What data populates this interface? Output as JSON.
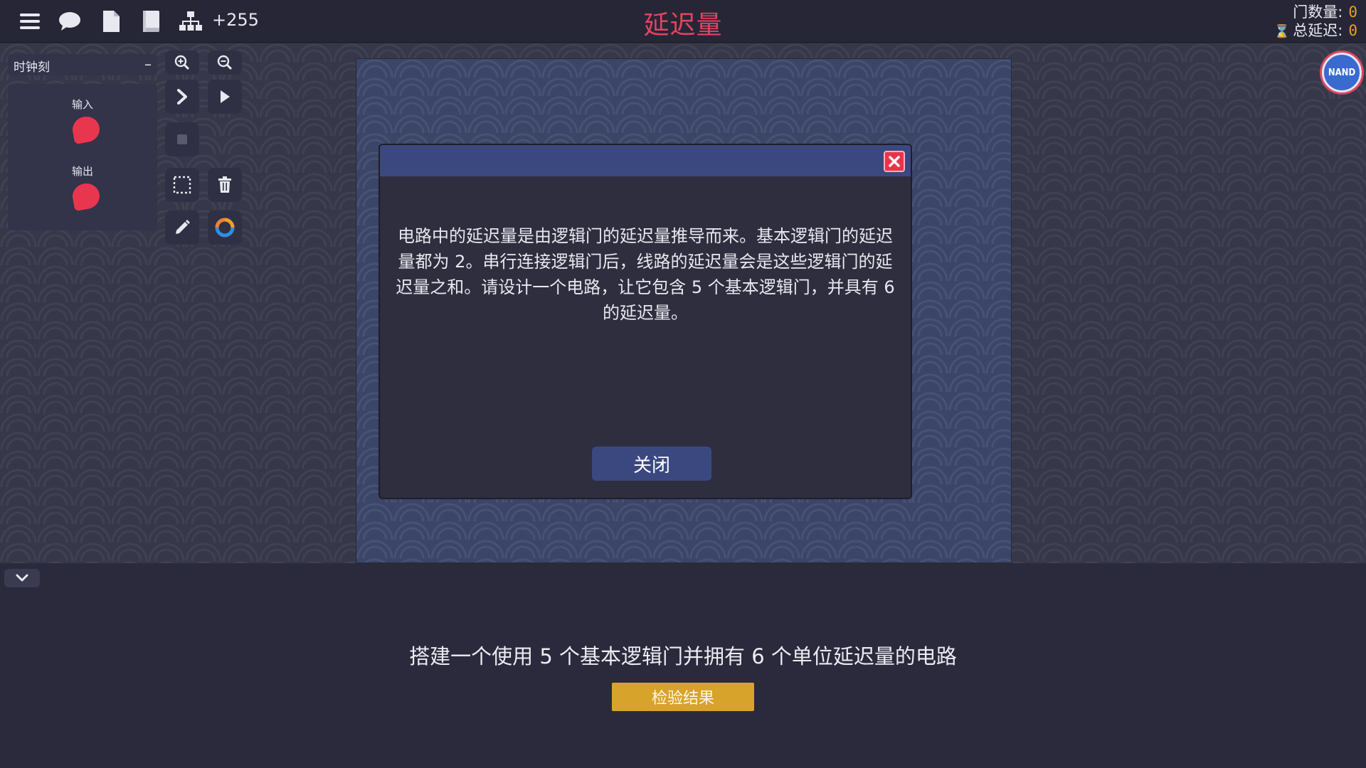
{
  "topbar": {
    "icons": [
      "menu-icon",
      "chat-icon",
      "document-icon",
      "book-icon",
      "hierarchy-icon"
    ],
    "score": "+255",
    "title": "延迟量",
    "gate_count_label": "门数量:",
    "gate_count_value": "0",
    "total_delay_label": "总延迟:",
    "total_delay_value": "0"
  },
  "palette": {
    "header": "时钟刻",
    "collapse_symbol": "–",
    "input_label": "输入",
    "output_label": "输出"
  },
  "tools": [
    "zoom-in-icon",
    "zoom-out-icon",
    "step-icon",
    "play-icon",
    "stop-icon",
    "select-icon",
    "trash-icon",
    "pencil-icon",
    "color-ring-icon"
  ],
  "badge": {
    "label": "NAND"
  },
  "dialog": {
    "text": "电路中的延迟量是由逻辑门的延迟量推导而来。基本逻辑门的延迟量都为 2。串行连接逻辑门后，线路的延迟量会是这些逻辑门的延迟量之和。请设计一个电路，让它包含 5 个基本逻辑门，并具有 6 的延迟量。",
    "close_button": "关闭"
  },
  "bottom": {
    "goal": "搭建一个使用 5 个基本逻辑门并拥有 6 个单位延迟量的电路",
    "check_button": "检验结果"
  },
  "colors": {
    "title": "#e0455f",
    "accent_blue": "#3b4880",
    "pin_red": "#e8364f",
    "check_button": "#d8a32a",
    "stat_value": "#e8a020"
  }
}
